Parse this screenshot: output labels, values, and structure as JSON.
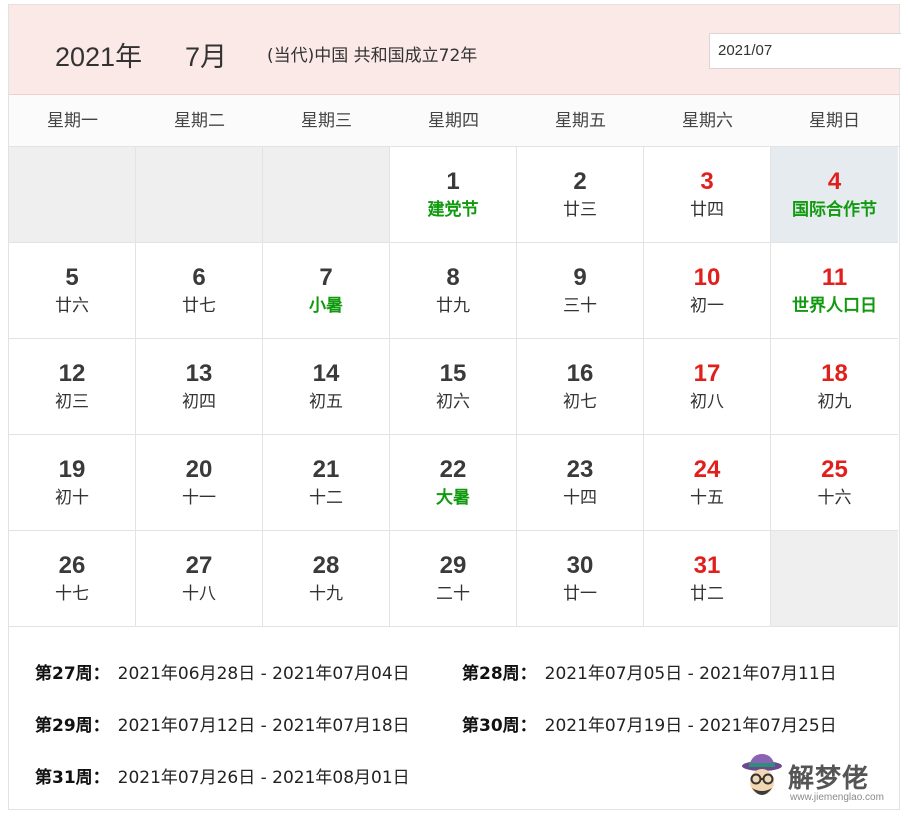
{
  "header": {
    "year": "2021年",
    "month": "7月",
    "subtitle": "(当代)中国 共和国成立72年",
    "picker_value": "2021/07"
  },
  "weekdays": [
    "星期一",
    "星期二",
    "星期三",
    "星期四",
    "星期五",
    "星期六",
    "星期日"
  ],
  "calendar": {
    "weeks": [
      [
        {
          "day": "",
          "lunar": "",
          "empty": true
        },
        {
          "day": "",
          "lunar": "",
          "empty": true
        },
        {
          "day": "",
          "lunar": "",
          "empty": true
        },
        {
          "day": "1",
          "lunar": "建党节",
          "festival": true
        },
        {
          "day": "2",
          "lunar": "廿三"
        },
        {
          "day": "3",
          "lunar": "廿四",
          "weekend": true
        },
        {
          "day": "4",
          "lunar": "国际合作节",
          "weekend": true,
          "festival": true,
          "today": true
        }
      ],
      [
        {
          "day": "5",
          "lunar": "廿六"
        },
        {
          "day": "6",
          "lunar": "廿七"
        },
        {
          "day": "7",
          "lunar": "小暑",
          "festival": true
        },
        {
          "day": "8",
          "lunar": "廿九"
        },
        {
          "day": "9",
          "lunar": "三十"
        },
        {
          "day": "10",
          "lunar": "初一",
          "weekend": true
        },
        {
          "day": "11",
          "lunar": "世界人口日",
          "weekend": true,
          "festival": true
        }
      ],
      [
        {
          "day": "12",
          "lunar": "初三"
        },
        {
          "day": "13",
          "lunar": "初四"
        },
        {
          "day": "14",
          "lunar": "初五"
        },
        {
          "day": "15",
          "lunar": "初六"
        },
        {
          "day": "16",
          "lunar": "初七"
        },
        {
          "day": "17",
          "lunar": "初八",
          "weekend": true
        },
        {
          "day": "18",
          "lunar": "初九",
          "weekend": true
        }
      ],
      [
        {
          "day": "19",
          "lunar": "初十"
        },
        {
          "day": "20",
          "lunar": "十一"
        },
        {
          "day": "21",
          "lunar": "十二"
        },
        {
          "day": "22",
          "lunar": "大暑",
          "festival": true
        },
        {
          "day": "23",
          "lunar": "十四"
        },
        {
          "day": "24",
          "lunar": "十五",
          "weekend": true
        },
        {
          "day": "25",
          "lunar": "十六",
          "weekend": true
        }
      ],
      [
        {
          "day": "26",
          "lunar": "十七"
        },
        {
          "day": "27",
          "lunar": "十八"
        },
        {
          "day": "28",
          "lunar": "十九"
        },
        {
          "day": "29",
          "lunar": "二十"
        },
        {
          "day": "30",
          "lunar": "廿一"
        },
        {
          "day": "31",
          "lunar": "廿二",
          "weekend": true
        },
        {
          "day": "",
          "lunar": "",
          "empty": true
        }
      ]
    ]
  },
  "week_ranges": [
    {
      "label": "第27周：",
      "range": "2021年06月28日 - 2021年07月04日"
    },
    {
      "label": "第28周：",
      "range": "2021年07月05日 - 2021年07月11日"
    },
    {
      "label": "第29周：",
      "range": "2021年07月12日 - 2021年07月18日"
    },
    {
      "label": "第30周：",
      "range": "2021年07月19日 - 2021年07月25日"
    },
    {
      "label": "第31周：",
      "range": "2021年07月26日 - 2021年08月01日"
    }
  ],
  "watermark": {
    "name": "解梦佬",
    "url": "www.jiemenglao.com"
  },
  "colors": {
    "header_bg": "#fbe9e7",
    "weekend_red": "#e0201c",
    "festival_green": "#119a0f",
    "today_bg": "#e6ebf0",
    "empty_bg": "#efefef"
  }
}
